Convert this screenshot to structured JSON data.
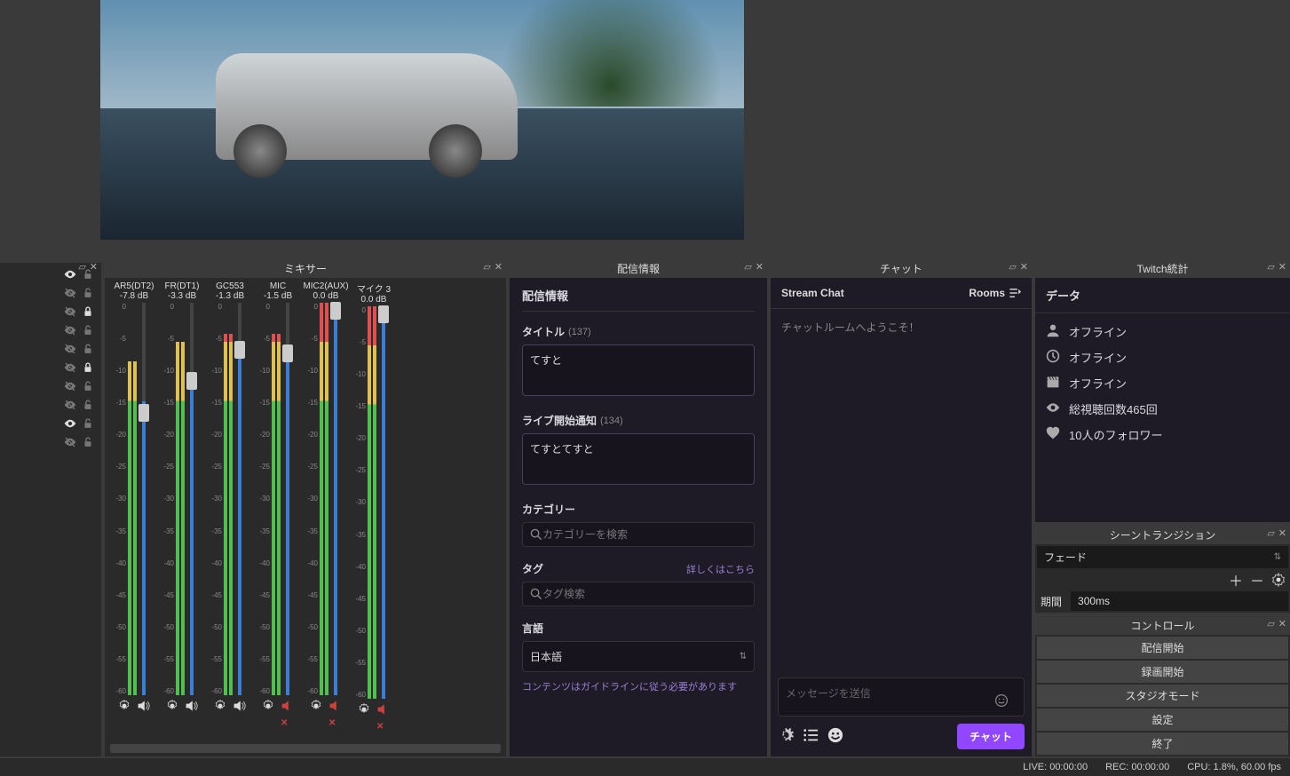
{
  "panels": {
    "sources_title": "",
    "mixer_title": "ミキサー",
    "info_title": "配信情報",
    "chat_title": "チャット",
    "stats_title": "Twitch統計",
    "trans_title": "シーントランジション",
    "ctrl_title": "コントロール"
  },
  "sources": [
    {
      "visible": true,
      "locked": false
    },
    {
      "visible": false,
      "locked": false
    },
    {
      "visible": false,
      "locked": true
    },
    {
      "visible": false,
      "locked": false
    },
    {
      "visible": false,
      "locked": false
    },
    {
      "visible": false,
      "locked": true
    },
    {
      "visible": false,
      "locked": false
    },
    {
      "visible": false,
      "locked": false
    },
    {
      "visible": true,
      "locked": false
    },
    {
      "visible": false,
      "locked": false
    }
  ],
  "mixer": {
    "scale_marks": [
      "0",
      "-5",
      "-10",
      "-15",
      "-20",
      "-25",
      "-30",
      "-35",
      "-40",
      "-45",
      "-50",
      "-55",
      "-60"
    ],
    "channels": [
      {
        "name": "AR5(DT2)",
        "db": "-7.8 dB",
        "fill": 75,
        "thumb": 72,
        "mask": 15,
        "muted": false
      },
      {
        "name": "FR(DT1)",
        "db": "-3.3 dB",
        "fill": 82,
        "thumb": 80,
        "mask": 10,
        "muted": false
      },
      {
        "name": "GC553",
        "db": "-1.3 dB",
        "fill": 90,
        "thumb": 88,
        "mask": 8,
        "muted": false
      },
      {
        "name": "MIC",
        "db": "-1.5 dB",
        "fill": 89,
        "thumb": 87,
        "mask": 8,
        "muted": true
      },
      {
        "name": "MIC2(AUX)",
        "db": "0.0 dB",
        "fill": 100,
        "thumb": 98,
        "mask": 0,
        "muted": true
      },
      {
        "name": "マイク 3",
        "db": "0.0 dB",
        "fill": 100,
        "thumb": 98,
        "mask": 0,
        "muted": true
      }
    ]
  },
  "info": {
    "section_title": "配信情報",
    "title_label": "タイトル",
    "title_count": "(137)",
    "title_value": "てすと",
    "notify_label": "ライブ開始通知",
    "notify_count": "(134)",
    "notify_value": "てすとてすと",
    "category_label": "カテゴリー",
    "category_placeholder": "カテゴリーを検索",
    "tag_label": "タグ",
    "tag_link": "詳しくはこちら",
    "tag_placeholder": "タグ検索",
    "lang_label": "言語",
    "lang_value": "日本語",
    "guideline": "コンテンツはガイドラインに従う必要があります"
  },
  "chat": {
    "header": "Stream Chat",
    "rooms_label": "Rooms",
    "welcome": "チャットルームへようこそ！",
    "input_placeholder": "メッセージを送信",
    "send_label": "チャット"
  },
  "stats": {
    "section_title": "データ",
    "rows": [
      {
        "icon": "user",
        "text": "オフライン"
      },
      {
        "icon": "clock",
        "text": "オフライン"
      },
      {
        "icon": "clap",
        "text": "オフライン"
      },
      {
        "icon": "eye",
        "text": "総視聴回数465回"
      },
      {
        "icon": "heart",
        "text": "10人のフォロワー"
      }
    ]
  },
  "trans": {
    "select_value": "フェード",
    "duration_label": "期間",
    "duration_value": "300ms"
  },
  "controls": {
    "buttons": [
      "配信開始",
      "録画開始",
      "スタジオモード",
      "設定",
      "終了"
    ]
  },
  "status": {
    "live": "LIVE: 00:00:00",
    "rec": "REC: 00:00:00",
    "cpu": "CPU: 1.8%, 60.00 fps"
  }
}
